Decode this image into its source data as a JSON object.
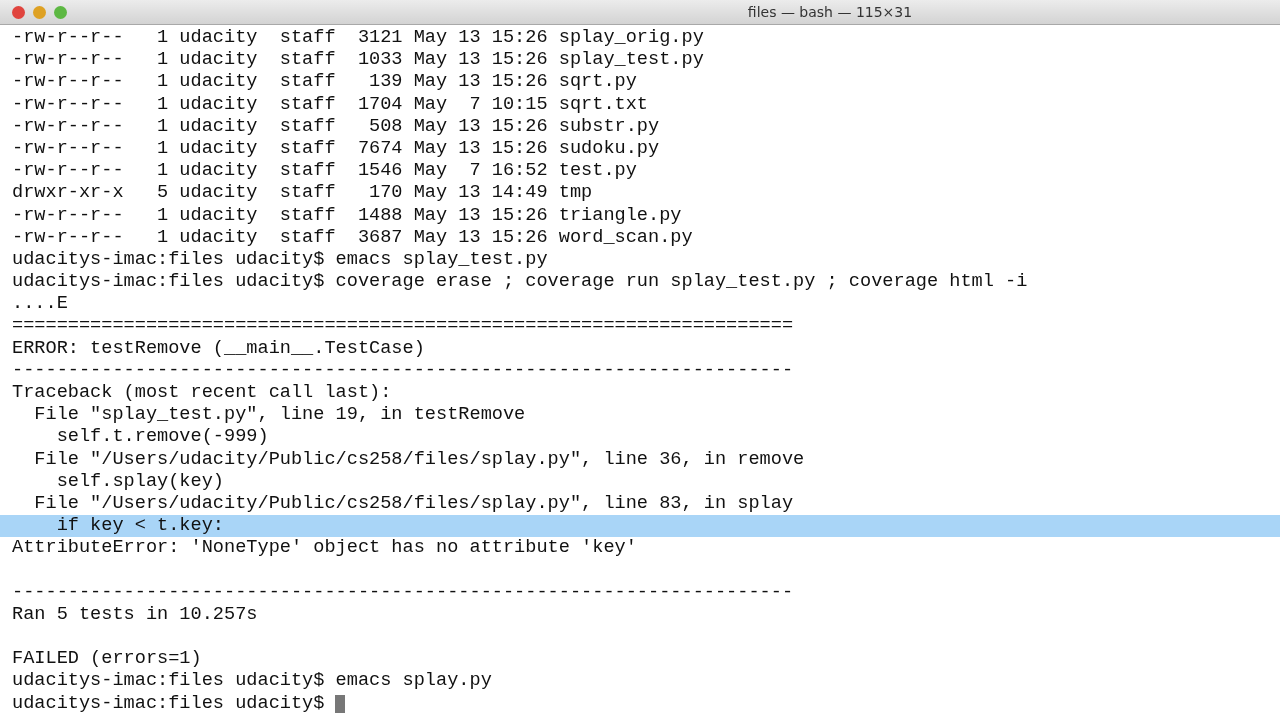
{
  "window": {
    "title": "files — bash — 115×31"
  },
  "terminal": {
    "lines": [
      {
        "kind": "output",
        "text": "-rw-r--r--   1 udacity  staff  3121 May 13 15:26 splay_orig.py",
        "highlighted": false
      },
      {
        "kind": "output",
        "text": "-rw-r--r--   1 udacity  staff  1033 May 13 15:26 splay_test.py",
        "highlighted": false
      },
      {
        "kind": "output",
        "text": "-rw-r--r--   1 udacity  staff   139 May 13 15:26 sqrt.py",
        "highlighted": false
      },
      {
        "kind": "output",
        "text": "-rw-r--r--   1 udacity  staff  1704 May  7 10:15 sqrt.txt",
        "highlighted": false
      },
      {
        "kind": "output",
        "text": "-rw-r--r--   1 udacity  staff   508 May 13 15:26 substr.py",
        "highlighted": false
      },
      {
        "kind": "output",
        "text": "-rw-r--r--   1 udacity  staff  7674 May 13 15:26 sudoku.py",
        "highlighted": false
      },
      {
        "kind": "output",
        "text": "-rw-r--r--   1 udacity  staff  1546 May  7 16:52 test.py",
        "highlighted": false
      },
      {
        "kind": "output",
        "text": "drwxr-xr-x   5 udacity  staff   170 May 13 14:49 tmp",
        "highlighted": false
      },
      {
        "kind": "output",
        "text": "-rw-r--r--   1 udacity  staff  1488 May 13 15:26 triangle.py",
        "highlighted": false
      },
      {
        "kind": "output",
        "text": "-rw-r--r--   1 udacity  staff  3687 May 13 15:26 word_scan.py",
        "highlighted": false
      },
      {
        "kind": "output",
        "text": "udacitys-imac:files udacity$ emacs splay_test.py",
        "highlighted": false
      },
      {
        "kind": "output",
        "text": "udacitys-imac:files udacity$ coverage erase ; coverage run splay_test.py ; coverage html -i",
        "highlighted": false
      },
      {
        "kind": "output",
        "text": "....E",
        "highlighted": false
      },
      {
        "kind": "output",
        "text": "======================================================================",
        "highlighted": false
      },
      {
        "kind": "output",
        "text": "ERROR: testRemove (__main__.TestCase)",
        "highlighted": false
      },
      {
        "kind": "output",
        "text": "----------------------------------------------------------------------",
        "highlighted": false
      },
      {
        "kind": "output",
        "text": "Traceback (most recent call last):",
        "highlighted": false
      },
      {
        "kind": "output",
        "text": "  File \"splay_test.py\", line 19, in testRemove",
        "highlighted": false
      },
      {
        "kind": "output",
        "text": "    self.t.remove(-999)",
        "highlighted": false
      },
      {
        "kind": "output",
        "text": "  File \"/Users/udacity/Public/cs258/files/splay.py\", line 36, in remove",
        "highlighted": false
      },
      {
        "kind": "output",
        "text": "    self.splay(key)",
        "highlighted": false
      },
      {
        "kind": "output",
        "text": "  File \"/Users/udacity/Public/cs258/files/splay.py\", line 83, in splay",
        "highlighted": false
      },
      {
        "kind": "output",
        "text": "    if key < t.key:",
        "highlighted": true
      },
      {
        "kind": "output",
        "text": "AttributeError: 'NoneType' object has no attribute 'key'",
        "highlighted": false
      },
      {
        "kind": "blank"
      },
      {
        "kind": "output",
        "text": "----------------------------------------------------------------------",
        "highlighted": false
      },
      {
        "kind": "output",
        "text": "Ran 5 tests in 10.257s",
        "highlighted": false
      },
      {
        "kind": "blank"
      },
      {
        "kind": "output",
        "text": "FAILED (errors=1)",
        "highlighted": false
      },
      {
        "kind": "output",
        "text": "udacitys-imac:files udacity$ emacs splay.py",
        "highlighted": false
      },
      {
        "kind": "input",
        "text": "udacitys-imac:files udacity$"
      }
    ]
  }
}
